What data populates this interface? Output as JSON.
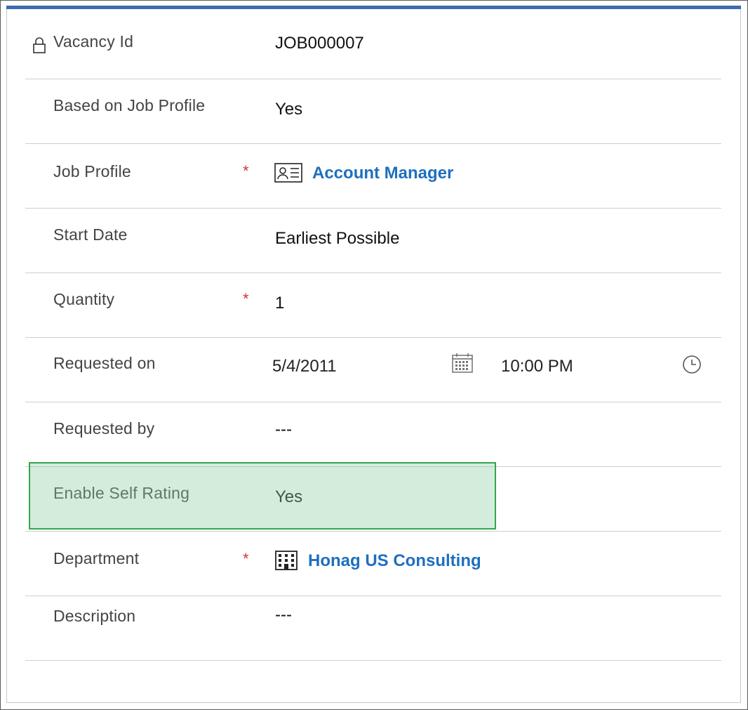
{
  "fields": [
    {
      "label": "Vacancy Id",
      "value": "JOB000007",
      "locked": true
    },
    {
      "label": "Based on Job Profile",
      "value": "Yes"
    },
    {
      "label": "Job Profile",
      "value": "Account Manager",
      "required": true,
      "link": true,
      "icon": "contact-card-icon"
    },
    {
      "label": "Start Date",
      "value": "Earliest Possible"
    },
    {
      "label": "Quantity",
      "value": "1",
      "required": true
    },
    {
      "label": "Requested on",
      "date": "5/4/2011",
      "time": "10:00 PM"
    },
    {
      "label": "Requested by",
      "value": "---"
    },
    {
      "label": "Enable Self Rating",
      "value": "Yes",
      "highlighted": true
    },
    {
      "label": "Department",
      "value": "Honag US Consulting",
      "required": true,
      "link": true,
      "icon": "building-icon"
    },
    {
      "label": "Description",
      "value": "---"
    }
  ],
  "required_marker": "*",
  "colors": {
    "accent_bar": "#3c6bb0",
    "link": "#1e6fbf",
    "required": "#d13438",
    "highlight_border": "#31a84a"
  }
}
